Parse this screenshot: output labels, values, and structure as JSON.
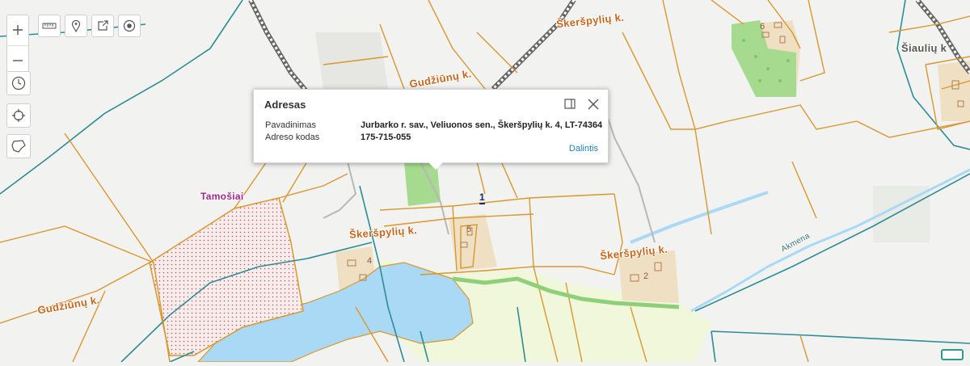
{
  "toolbar": {
    "zoom_in_icon": "plus-icon",
    "zoom_out_icon": "minus-icon",
    "measure_icon": "ruler-icon",
    "marker_icon": "pin-icon",
    "share_icon": "share-icon",
    "locate_icon": "target-icon",
    "history_icon": "clock-icon",
    "crosshair_icon": "crosshair-icon",
    "lasso_icon": "lasso-icon"
  },
  "map_labels": {
    "skerspyliu_top": "Škeršpylių k.",
    "gudziunu_top": "Gudžiūnų k.",
    "siauliu": "Šiaulių k",
    "tamosiai": "Tamošiai",
    "skerspyliu_mid": "Škeršpylių k.",
    "skerspyliu_right": "Škeršpylių k.",
    "gudziunu_left": "Gudžiūnų k.",
    "akmena": "Akmena",
    "num_6": "6",
    "num_5": "5",
    "num_4": "4",
    "num_2": "2",
    "num_1": "1"
  },
  "popup": {
    "title": "Adresas",
    "rows": [
      {
        "label": "Pavadinimas",
        "value": "Jurbarko r. sav., Veliuonos sen., Škeršpylių k. 4, LT-74364"
      },
      {
        "label": "Adreso kodas",
        "value": "175-715-055"
      }
    ],
    "share_label": "Dalintis"
  },
  "colors": {
    "parcel": "#d9972e",
    "road_teal": "#2e8c94",
    "water": "#a9d9f4",
    "green": "#a6db8f",
    "meadow": "#f1f7da",
    "building_area": "#efe0c4",
    "label": "#c8651b",
    "tamosiai_label": "#a5238d"
  }
}
